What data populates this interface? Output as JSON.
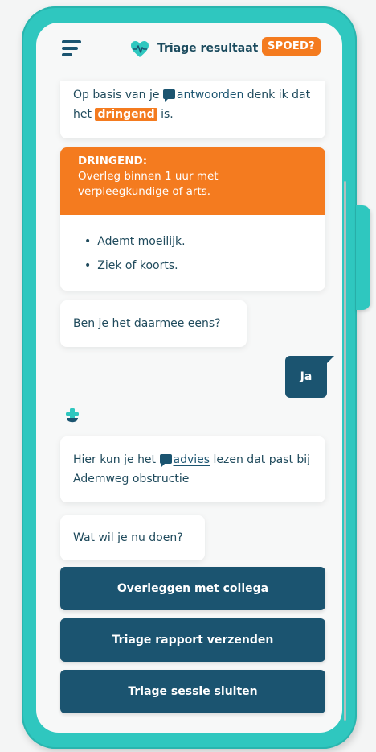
{
  "header": {
    "title": "Triage resultaat",
    "badge": "SPOED?",
    "menu_icon": "hamburger-menu-icon",
    "logo_icon": "heart-pulse-icon"
  },
  "messages": {
    "intro_prefix": "Op basis van je",
    "intro_link": "antwoorden",
    "intro_mid": "denk ik dat het",
    "intro_highlight": "dringend",
    "intro_suffix": "is.",
    "dringend_title": "DRINGEND:",
    "dringend_text": "Overleg binnen 1 uur met verpleegkundige of arts.",
    "reasons": [
      "Ademt moeilijk.",
      "Ziek of koorts."
    ],
    "question": "Ben je het daarmee eens?",
    "user_reply": "Ja",
    "advice_prefix": "Hier kun je het",
    "advice_link": "advies",
    "advice_suffix": "lezen dat past bij Ademweg obstructie",
    "next_question": "Wat wil je nu doen?"
  },
  "actions": {
    "consult": "Overleggen met collega",
    "send_report": "Triage rapport verzenden",
    "close_session": "Triage sessie sluiten"
  },
  "colors": {
    "primary": "#1b5470",
    "accent": "#f47b1f",
    "frame": "#2fc7bf"
  }
}
